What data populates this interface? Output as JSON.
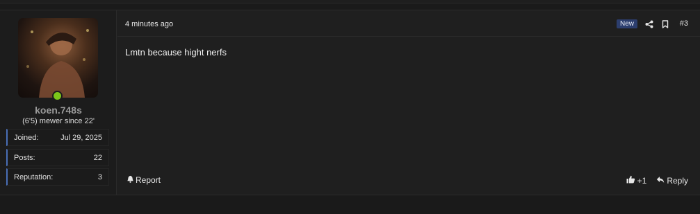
{
  "post": {
    "time": "4 minutes ago",
    "badge_new": "New",
    "post_number": "#3",
    "message": "Lmtn because hight nerfs",
    "report_label": "Report",
    "reaction_count": "+1",
    "reply_label": "Reply"
  },
  "user": {
    "name": "koen.748s",
    "title": "(6'5) mewer since 22'",
    "stats": [
      {
        "label": "Joined:",
        "value": "Jul 29, 2025"
      },
      {
        "label": "Posts:",
        "value": "22"
      },
      {
        "label": "Reputation:",
        "value": "3"
      }
    ]
  },
  "colors": {
    "online": "#7cc61a",
    "badge": "#2c3e6e",
    "stat_accent": "#4a6fb8"
  },
  "icons": [
    "share-icon",
    "bookmark-icon",
    "bell-icon",
    "thumbs-up-icon",
    "reply-icon"
  ]
}
